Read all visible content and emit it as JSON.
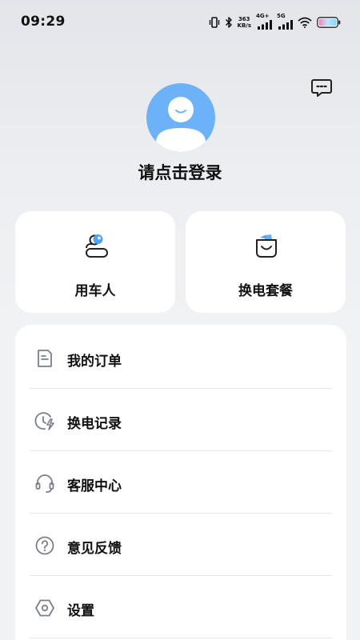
{
  "status_bar": {
    "time": "09:29",
    "net_speed_value": "363",
    "net_speed_unit": "KB/s",
    "signal_1_tag": "4G+",
    "signal_2_tag": "5G",
    "icons": [
      "vibrate-icon",
      "bluetooth-icon",
      "signal-icon",
      "wifi-icon",
      "battery-icon"
    ]
  },
  "header": {
    "message_icon": "message-icon",
    "login_prompt": "请点击登录"
  },
  "quick_cards": [
    {
      "label": "用车人",
      "icon": "user-vehicle-icon"
    },
    {
      "label": "换电套餐",
      "icon": "shopping-bag-icon"
    }
  ],
  "menu": {
    "items": [
      {
        "label": "我的订单",
        "icon": "document-icon"
      },
      {
        "label": "换电记录",
        "icon": "clock-lightning-icon"
      },
      {
        "label": "客服中心",
        "icon": "headset-icon"
      },
      {
        "label": "意见反馈",
        "icon": "question-icon"
      },
      {
        "label": "设置",
        "icon": "settings-hex-icon"
      }
    ]
  },
  "colors": {
    "avatar": "#6cb2f8",
    "accent_blue": "#4aa3f4",
    "icon_gray": "#7a7f88",
    "text": "#111111",
    "card_bg": "#ffffff"
  }
}
